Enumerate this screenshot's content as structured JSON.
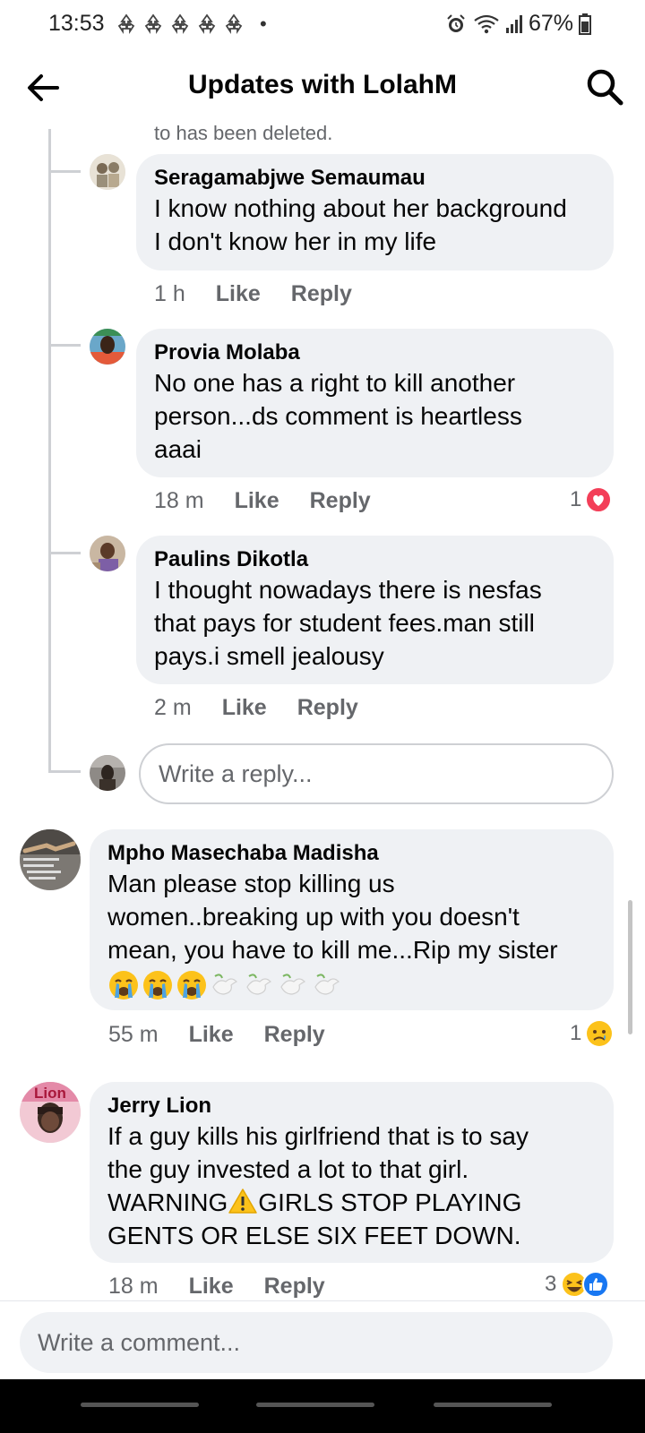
{
  "status_bar": {
    "time": "13:53",
    "battery": "67%",
    "notification_icons": [
      "recycle-icon",
      "recycle-icon",
      "recycle-icon",
      "recycle-icon",
      "recycle-icon"
    ]
  },
  "header": {
    "title": "Updates with LolahM"
  },
  "thread": {
    "deleted_notice": "to has been deleted.",
    "replies": [
      {
        "name": "Seragamabjwe Semaumau",
        "text": "I know nothing about her background\nI don't know her in my life",
        "time": "1 h",
        "like": "Like",
        "reply": "Reply"
      },
      {
        "name": "Provia Molaba",
        "text": "No one has a right to kill another\nperson...ds comment is heartless\naaai",
        "time": "18 m",
        "like": "Like",
        "reply": "Reply",
        "reaction_count": "1",
        "reaction": "love"
      },
      {
        "name": "Paulins Dikotla",
        "text": "I thought nowadays there is nesfas\nthat pays for student fees.man still\npays.i smell jealousy",
        "time": "2 m",
        "like": "Like",
        "reply": "Reply"
      }
    ],
    "reply_placeholder": "Write a reply..."
  },
  "comments": [
    {
      "name": "Mpho Masechaba Madisha",
      "text": "Man please stop killing us\nwomen..breaking up with you doesn't\nmean, you have to kill me...Rip my sister",
      "emojis": [
        "crying-face",
        "crying-face",
        "crying-face",
        "dove",
        "dove",
        "dove",
        "dove"
      ],
      "time": "55 m",
      "like": "Like",
      "reply": "Reply",
      "reaction_count": "1",
      "reaction": "sad"
    },
    {
      "name": "Jerry Lion",
      "avatar_text": "Lion",
      "text_before_warning": "If a guy kills his girlfriend that is to say\nthe guy invested a lot to that girl.\nWARNING",
      "text_after_warning": "GIRLS STOP PLAYING\nGENTS OR ELSE SIX FEET DOWN.",
      "time": "18 m",
      "like": "Like",
      "reply": "Reply",
      "reaction_count": "3",
      "reactions": [
        "haha",
        "like"
      ]
    }
  ],
  "comment_box": {
    "placeholder": "Write a comment..."
  },
  "colors": {
    "bubble": "#eff1f4",
    "meta_text": "#65676b",
    "thread_line": "#ced0d4",
    "love": "#f33e58",
    "like": "#1877f2",
    "emoji_yellow": "#fcc21b"
  }
}
